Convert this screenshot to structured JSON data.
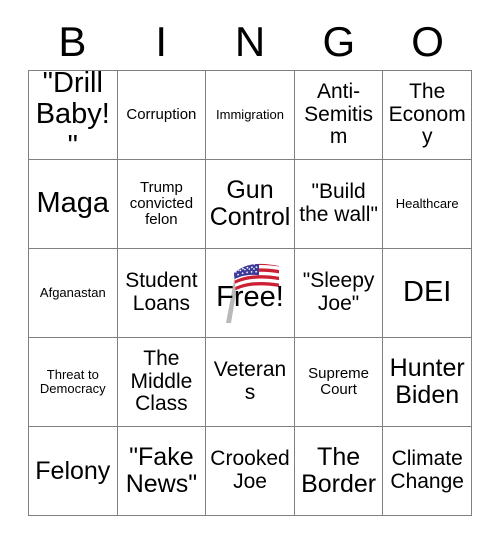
{
  "header": {
    "letters": [
      "B",
      "I",
      "N",
      "G",
      "O"
    ]
  },
  "grid": {
    "rows": [
      [
        {
          "label": "\"Drill Baby!\"",
          "size": "fs-xl"
        },
        {
          "label": "Corruption",
          "size": "fs-sm"
        },
        {
          "label": "Immigration",
          "size": "fs-xs"
        },
        {
          "label": "Anti-Semitism",
          "size": "fs-md"
        },
        {
          "label": "The Economy",
          "size": "fs-md"
        }
      ],
      [
        {
          "label": "Maga",
          "size": "fs-xl"
        },
        {
          "label": "Trump convicted felon",
          "size": "fs-sm"
        },
        {
          "label": "Gun Control",
          "size": "fs-lg"
        },
        {
          "label": "\"Build the wall\"",
          "size": "fs-md"
        },
        {
          "label": "Healthcare",
          "size": "fs-xs"
        }
      ],
      [
        {
          "label": "Afganastan",
          "size": "fs-xs"
        },
        {
          "label": "Student Loans",
          "size": "fs-md"
        },
        {
          "label": "Free!",
          "size": "fs-xl",
          "free_space": true,
          "icon": "us-flag-icon"
        },
        {
          "label": "\"Sleepy Joe\"",
          "size": "fs-md"
        },
        {
          "label": "DEI",
          "size": "fs-xl"
        }
      ],
      [
        {
          "label": "Threat to Democracy",
          "size": "fs-xs"
        },
        {
          "label": "The Middle Class",
          "size": "fs-md"
        },
        {
          "label": "Veterans",
          "size": "fs-md"
        },
        {
          "label": "Supreme Court",
          "size": "fs-sm"
        },
        {
          "label": "Hunter Biden",
          "size": "fs-lg"
        }
      ],
      [
        {
          "label": "Felony",
          "size": "fs-lg"
        },
        {
          "label": "\"Fake News\"",
          "size": "fs-lg"
        },
        {
          "label": "Crooked Joe",
          "size": "fs-md"
        },
        {
          "label": "The Border",
          "size": "fs-lg"
        },
        {
          "label": "Climate Change",
          "size": "fs-md"
        }
      ]
    ]
  },
  "colors": {
    "grid_line": "#808080",
    "text": "#000000",
    "background": "#ffffff",
    "flag_red": "#cc2035",
    "flag_blue": "#3c3b9b",
    "flag_white": "#ffffff",
    "flag_pole": "#b0b0b0"
  }
}
